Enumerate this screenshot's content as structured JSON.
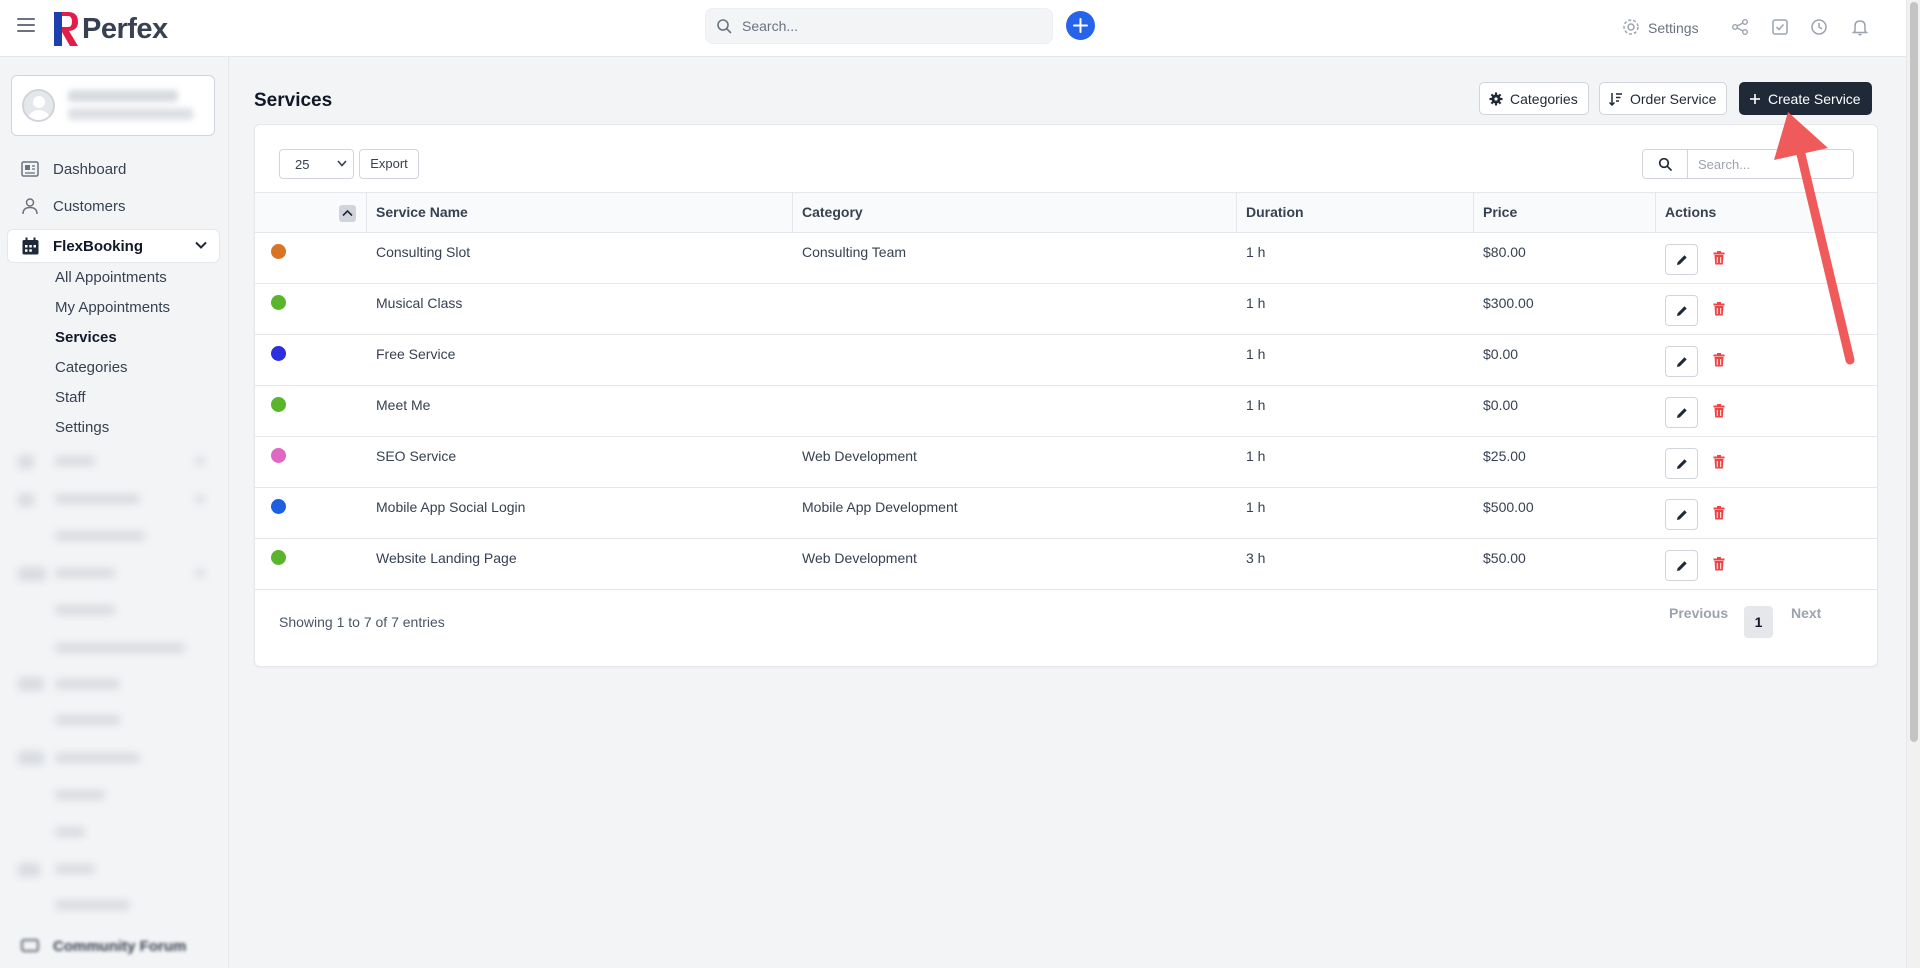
{
  "app": {
    "brand": "Perfex"
  },
  "topbar": {
    "search_placeholder": "Search...",
    "settings_label": "Settings"
  },
  "sidebar": {
    "items": [
      {
        "label": "Dashboard"
      },
      {
        "label": "Customers"
      },
      {
        "label": "FlexBooking"
      }
    ],
    "flexbooking_sub": [
      {
        "label": "All Appointments"
      },
      {
        "label": "My Appointments"
      },
      {
        "label": "Services"
      },
      {
        "label": "Categories"
      },
      {
        "label": "Staff"
      },
      {
        "label": "Settings"
      }
    ],
    "bottom_item": "Community Forum"
  },
  "page": {
    "title": "Services",
    "buttons": {
      "categories": "Categories",
      "order": "Order Service",
      "create": "Create Service"
    }
  },
  "table": {
    "length_value": "25",
    "export_label": "Export",
    "search_placeholder": "Search...",
    "columns": [
      "Service Name",
      "Category",
      "Duration",
      "Price",
      "Actions"
    ],
    "rows": [
      {
        "color": "#d97326",
        "name": "Consulting Slot",
        "category": "Consulting Team",
        "duration": "1 h",
        "price": "$80.00"
      },
      {
        "color": "#5ab52d",
        "name": "Musical Class",
        "category": "",
        "duration": "1 h",
        "price": "$300.00"
      },
      {
        "color": "#2b2fe0",
        "name": "Free Service",
        "category": "",
        "duration": "1 h",
        "price": "$0.00"
      },
      {
        "color": "#5ab52d",
        "name": "Meet Me",
        "category": "",
        "duration": "1 h",
        "price": "$0.00"
      },
      {
        "color": "#e167c5",
        "name": "SEO Service",
        "category": "Web Development",
        "duration": "1 h",
        "price": "$25.00"
      },
      {
        "color": "#1d5fe0",
        "name": "Mobile App Social Login",
        "category": "Mobile App Development",
        "duration": "1 h",
        "price": "$500.00"
      },
      {
        "color": "#5ab52d",
        "name": "Website Landing Page",
        "category": "Web Development",
        "duration": "3 h",
        "price": "$50.00"
      }
    ],
    "info": "Showing 1 to 7 of 7 entries",
    "pagination": {
      "previous": "Previous",
      "current": "1",
      "next": "Next"
    }
  },
  "colors": {
    "accent": "#2563eb",
    "dark_button": "#1f2937",
    "annotation_arrow": "#ef5a5a",
    "delete": "#ef4444"
  }
}
